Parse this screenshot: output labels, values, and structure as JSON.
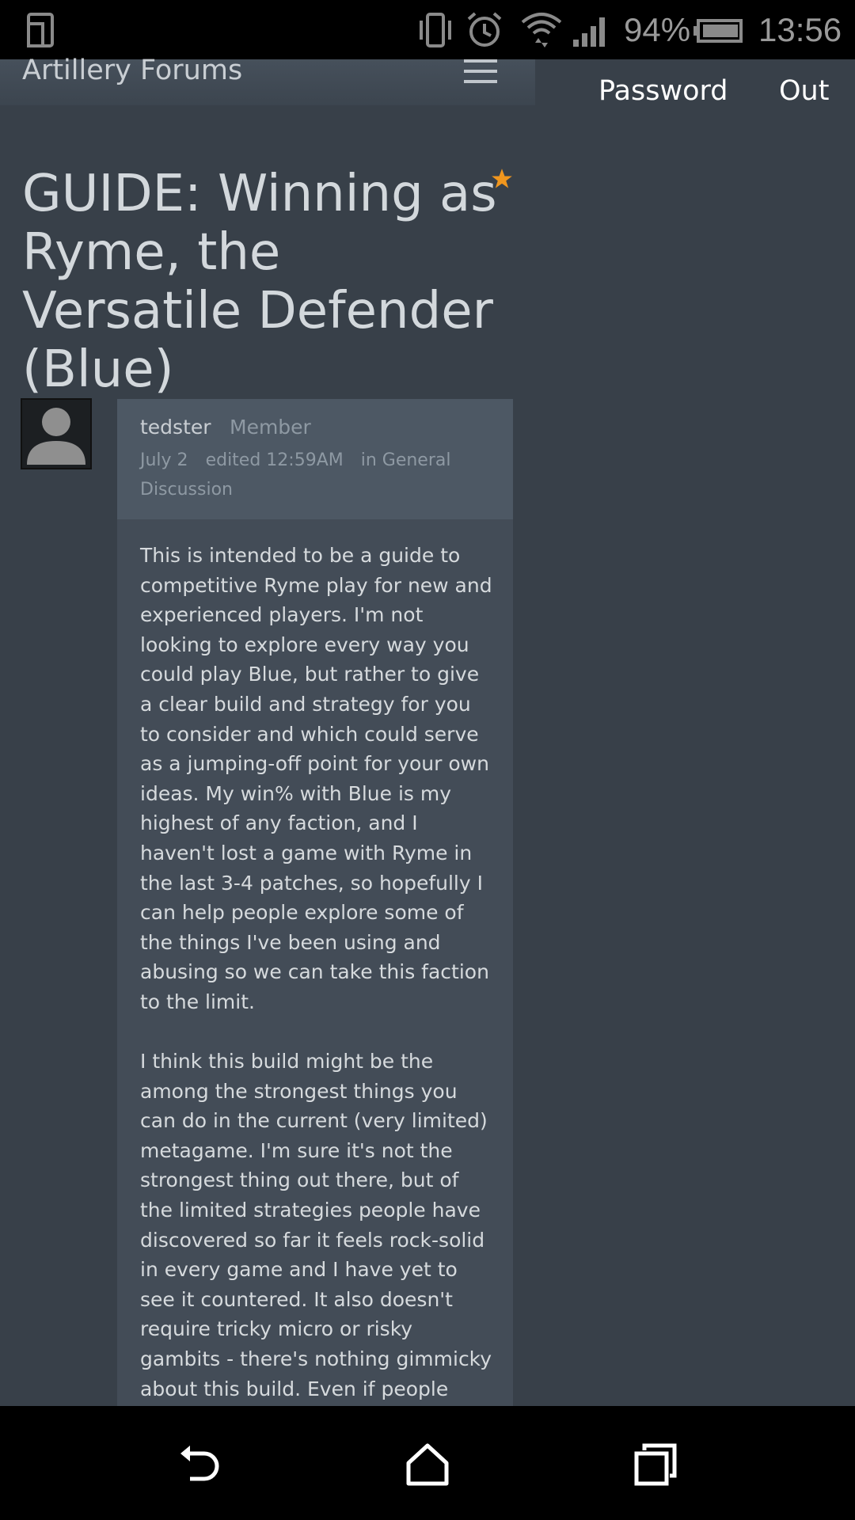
{
  "status_bar": {
    "battery_percent": "94%",
    "time": "13:56",
    "icons": [
      "screen-rotate-icon",
      "vibrate-icon",
      "alarm-icon",
      "wifi-icon",
      "signal-icon",
      "battery-icon"
    ]
  },
  "header": {
    "site_title": "Artillery Forums",
    "menu_icon": "hamburger-menu-icon",
    "links": [
      "Password",
      "Out"
    ]
  },
  "thread": {
    "title": "GUIDE: Winning as Ryme, the Versatile Defender (Blue)",
    "starred": true
  },
  "post": {
    "author": "tedster",
    "role": "Member",
    "date": "July 2",
    "edited": "edited 12:59AM",
    "category": "in General Discussion",
    "paragraphs": [
      "This is intended to be a guide to competitive Ryme play for new and experienced players. I'm not looking to explore every way you could play Blue, but rather to give a clear build and strategy for you to consider and which could serve as a jumping-off point for your own ideas. My win% with Blue is my highest of any faction, and I haven't lost a game with Ryme in the last 3-4 patches, so hopefully I can help people explore some of the things I've been using and abusing so we can take this faction to the limit.",
      "I think this build might be the among the strongest things you can do in the current (very limited) metagame. I'm sure it's not the strongest thing out there, but of the limited strategies people have discovered so far it feels rock-solid in every game and I have yet to see it countered. It also doesn't require tricky micro or risky gambits - there's nothing gimmicky about this build. Even if people know it is coming, you are forcing them to"
    ]
  },
  "nav_bar": {
    "buttons": [
      "back-icon",
      "home-icon",
      "recent-apps-icon"
    ]
  },
  "colors": {
    "background": "#384049",
    "post_header": "#4d5864",
    "post_body": "#434c57",
    "star": "#f0961e"
  }
}
